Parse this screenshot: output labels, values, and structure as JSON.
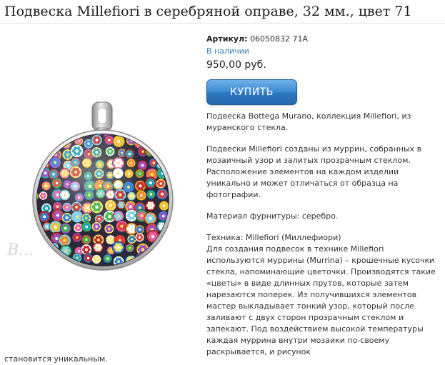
{
  "product": {
    "title": "Подвеска Millefiori в серебряной оправе, 32 мм., цвет 71",
    "sku_label": "Артикул:",
    "sku_value": "06050832 71A",
    "stock": "В наличии",
    "price": "950,00 руб.",
    "buy_label": "КУПИТЬ",
    "watermark": "B..."
  },
  "description": {
    "p1": "Подвеска Bottega Murano, коллекция Millefiori, из муранского стекла.",
    "p2": "Подвески Millefiori созданы из муррин, собранных в мозаичный узор и залитых прозрачным стеклом. Расположение элементов на каждом изделии уникально и может отличаться от образца на фотографии.",
    "p3": "Материал фурнитуры: серебро.",
    "technique_label": "Техника: Millefiori (Миллефиори)",
    "p4": "Для создания подвесок в технике Millefiori используются муррины (Murrina) – крошечные кусочки стекла, напоминающие цветочки. Производятся такие «цветы» в виде длинных прутов, которые затем нарезаются поперек. Из получившихся элементов мастер выкладывает тонкий узор, который после заливают с двух сторон прозрачным стеклом и запекают. Под воздействием высокой температуры каждая муррина внутри мозаики по-своему раскрывается, и рисунок",
    "overflow": "становится уникальным."
  },
  "colors": {
    "link_blue": "#3a7fc0",
    "button_blue": "#3c8ad2"
  }
}
